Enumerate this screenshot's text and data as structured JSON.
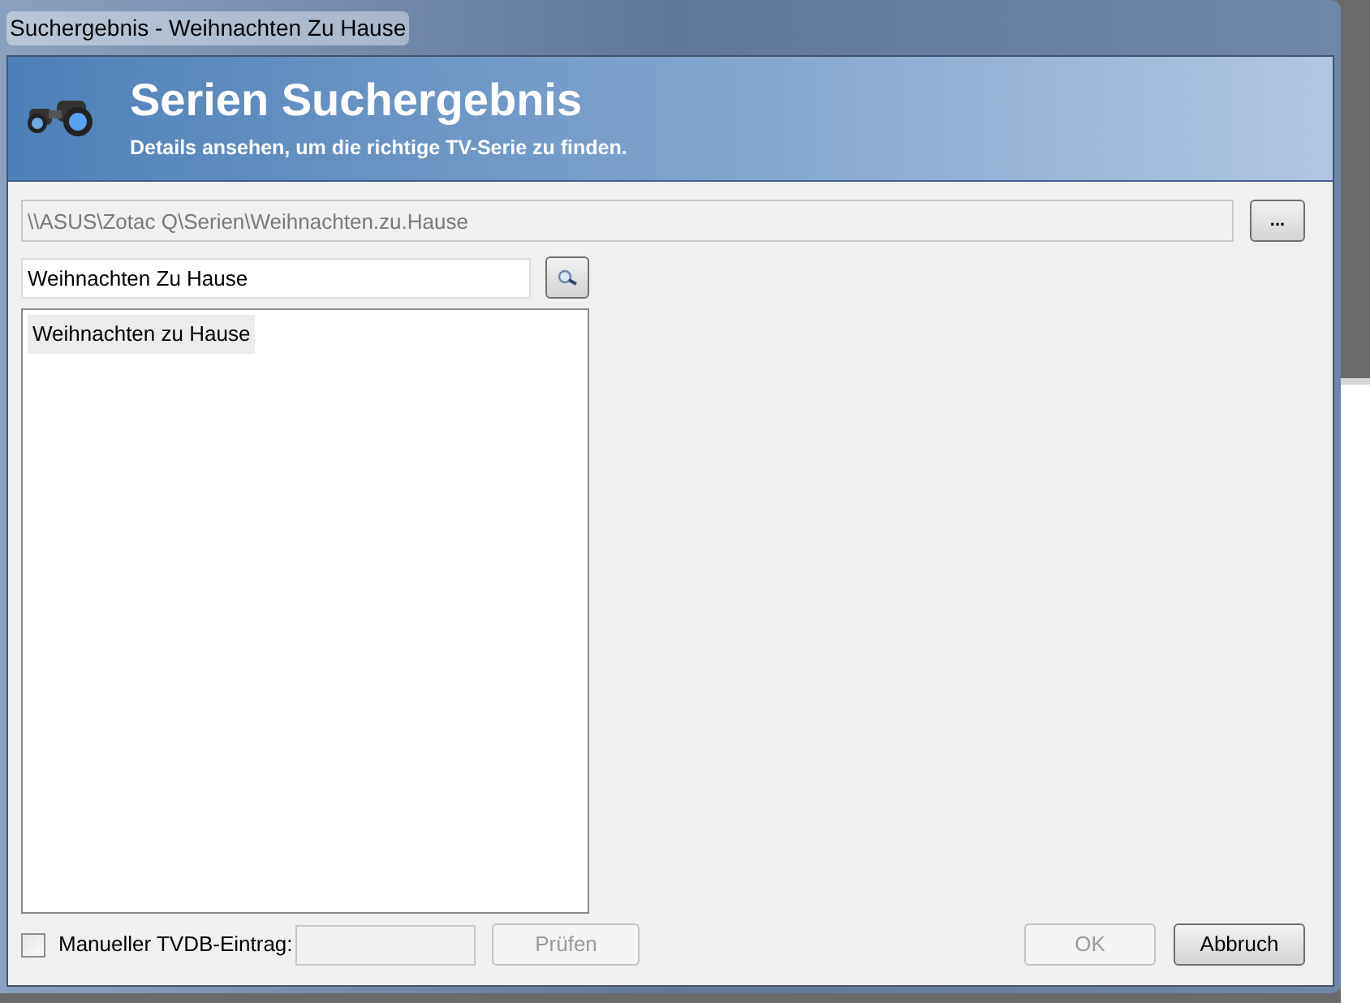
{
  "window": {
    "title": "Suchergebnis - Weihnachten Zu Hause"
  },
  "header": {
    "title": "Serien Suchergebnis",
    "subtitle": "Details ansehen, um die richtige TV-Serie zu finden."
  },
  "path_field": {
    "value": "\\\\ASUS\\Zotac Q\\Serien\\Weihnachten.zu.Hause",
    "disabled": true
  },
  "browse_button": {
    "label": "..."
  },
  "search_field": {
    "value": "Weihnachten Zu Hause"
  },
  "results": [
    {
      "label": "Weihnachten zu Hause",
      "selected": true
    }
  ],
  "manual_entry": {
    "label": "Manueller TVDB-Eintrag:",
    "checked": false,
    "field_disabled": true
  },
  "buttons": [
    {
      "kind": "check",
      "label": "Prüfen",
      "disabled": true
    },
    {
      "kind": "ok",
      "label": "OK",
      "disabled": true
    },
    {
      "kind": "cancel",
      "label": "Abbruch",
      "disabled": false
    }
  ]
}
